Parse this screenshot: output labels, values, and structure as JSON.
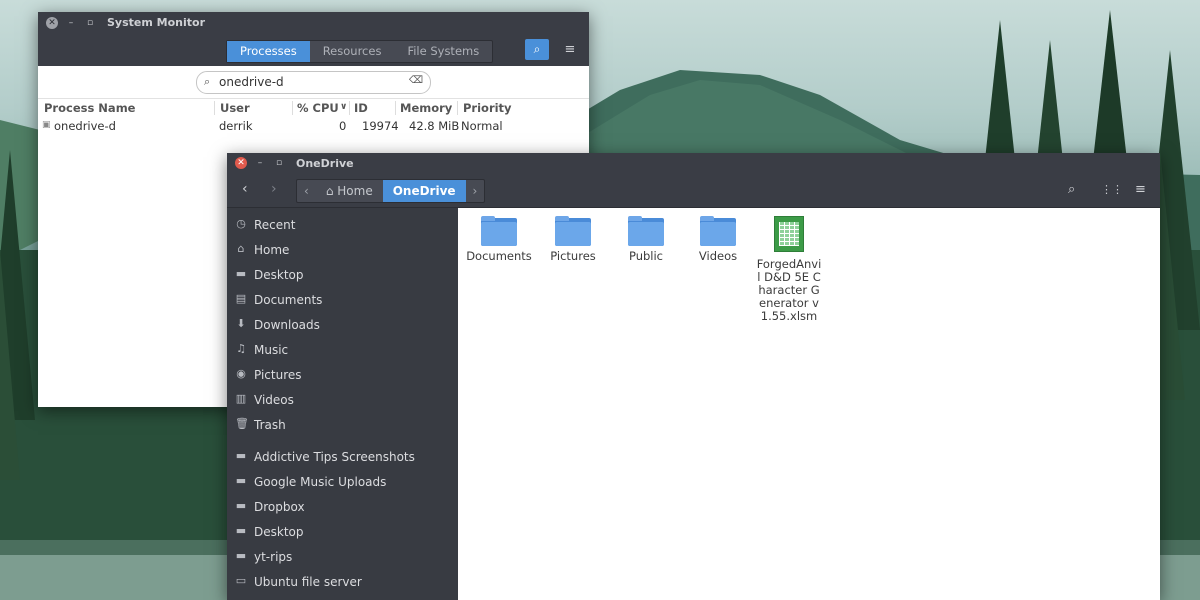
{
  "sysmon": {
    "title": "System Monitor",
    "tabs": [
      {
        "label": "Processes",
        "active": true
      },
      {
        "label": "Resources",
        "active": false
      },
      {
        "label": "File Systems",
        "active": false
      }
    ],
    "search_value": "onedrive-d",
    "columns": [
      "Process Name",
      "User",
      "% CPU",
      "ID",
      "Memory",
      "Priority"
    ],
    "rows": [
      {
        "name": "onedrive-d",
        "user": "derrik",
        "cpu": "0",
        "id": "19974",
        "memory": "42.8 MiB",
        "priority": "Normal"
      }
    ]
  },
  "files": {
    "title": "OneDrive",
    "path": [
      {
        "label": "Home",
        "active": false
      },
      {
        "label": "OneDrive",
        "active": true
      }
    ],
    "sidebar_places": [
      {
        "label": "Recent",
        "icon": "clock-icon"
      },
      {
        "label": "Home",
        "icon": "home-icon"
      },
      {
        "label": "Desktop",
        "icon": "desktop-folder-icon"
      },
      {
        "label": "Documents",
        "icon": "document-icon"
      },
      {
        "label": "Downloads",
        "icon": "download-icon"
      },
      {
        "label": "Music",
        "icon": "music-icon"
      },
      {
        "label": "Pictures",
        "icon": "camera-icon"
      },
      {
        "label": "Videos",
        "icon": "film-icon"
      },
      {
        "label": "Trash",
        "icon": "trash-icon"
      }
    ],
    "sidebar_bookmarks": [
      {
        "label": "Addictive Tips Screenshots",
        "icon": "folder-icon"
      },
      {
        "label": "Google Music Uploads",
        "icon": "folder-icon"
      },
      {
        "label": "Dropbox",
        "icon": "folder-icon"
      },
      {
        "label": "Desktop",
        "icon": "folder-icon"
      },
      {
        "label": "yt-rips",
        "icon": "folder-icon"
      },
      {
        "label": "Ubuntu file server",
        "icon": "drive-icon"
      }
    ],
    "items": [
      {
        "name": "Documents",
        "type": "folder"
      },
      {
        "name": "Pictures",
        "type": "folder"
      },
      {
        "name": "Public",
        "type": "folder"
      },
      {
        "name": "Videos",
        "type": "folder"
      },
      {
        "name": "ForgedAnvil D&D 5E Character Generator v1.55.xlsm",
        "type": "spreadsheet"
      }
    ]
  }
}
